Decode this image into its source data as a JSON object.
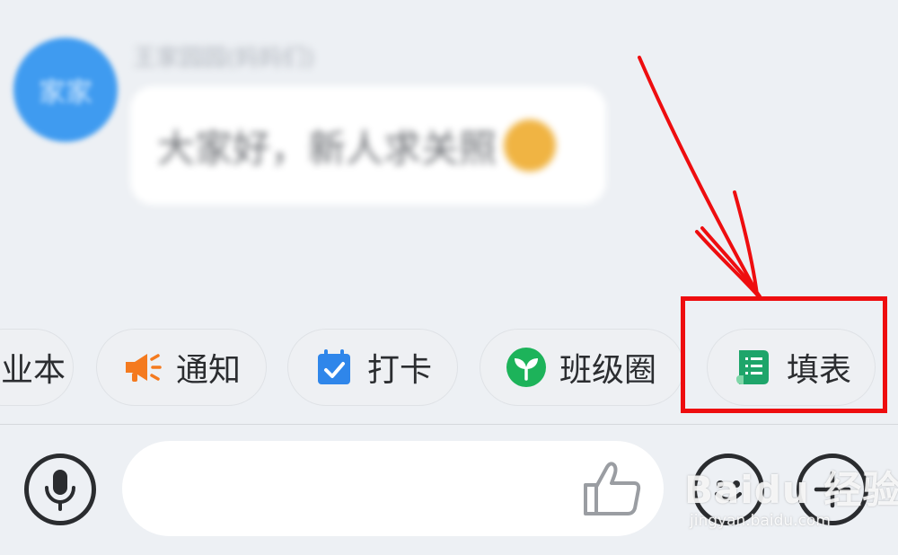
{
  "chat": {
    "sender_name": "王家园园(妈妈们)",
    "avatar_text": "家家",
    "message": "大家好，新人求关照"
  },
  "quick_actions": [
    {
      "label": "业本",
      "icon": "notebook-icon"
    },
    {
      "label": "通知",
      "icon": "megaphone-icon",
      "color": "#f47a1f"
    },
    {
      "label": "打卡",
      "icon": "calendar-check-icon",
      "color": "#2f86ea"
    },
    {
      "label": "班级圈",
      "icon": "sprout-icon",
      "color": "#1db35a"
    },
    {
      "label": "填表",
      "icon": "form-sheet-icon",
      "color": "#1ea56a"
    }
  ],
  "input_bar": {
    "placeholder": "",
    "like_icon": "thumbs-up-icon",
    "voice_icon": "microphone-icon",
    "emoji_icon": "smiley-icon",
    "more_icon": "plus-icon"
  },
  "annotation": {
    "color": "#ee0d0f",
    "target": "填表"
  },
  "watermark": {
    "brand": "Baidu 经验",
    "url": "jingyan.baidu.com"
  }
}
